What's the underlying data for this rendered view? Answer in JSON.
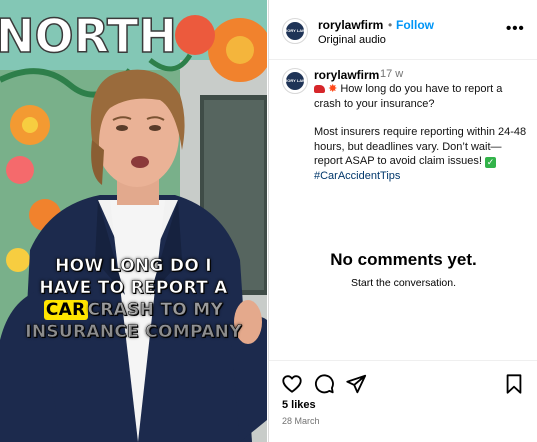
{
  "video": {
    "caption_line1": "HOW LONG DO I",
    "caption_line2": "HAVE TO REPORT A",
    "caption_word_highlight": "CAR",
    "caption_line3_rest": "CRASH TO MY",
    "caption_line4": "INSURANCE COMPANY",
    "mural_text": "NORTH"
  },
  "header": {
    "username": "rorylawfirm",
    "separator": "•",
    "follow_label": "Follow",
    "audio_label": "Original audio",
    "more_label": "•••",
    "avatar_text": "RORY LAW"
  },
  "post": {
    "username": "rorylawfirm",
    "time_ago": "17 w",
    "line1": "How long do you have to report a crash to your insurance?",
    "line2": "Most insurers require reporting within 24-48 hours, but deadlines vary. Don’t wait—report ASAP to avoid claim issues!",
    "hashtag": "#CarAccidentTips",
    "emoji_check": "✓",
    "emoji_boom": "✸"
  },
  "comments": {
    "empty_title": "No comments yet.",
    "empty_subtitle": "Start the conversation."
  },
  "actions": {
    "likes": "5 likes",
    "date": "28 March",
    "icons": [
      "heart-icon",
      "comment-icon",
      "share-icon",
      "bookmark-icon"
    ]
  },
  "colors": {
    "follow_blue": "#0095f6",
    "hashtag_blue": "#00376b",
    "muted_gray": "#737373",
    "caption_highlight": "#ffe500"
  }
}
